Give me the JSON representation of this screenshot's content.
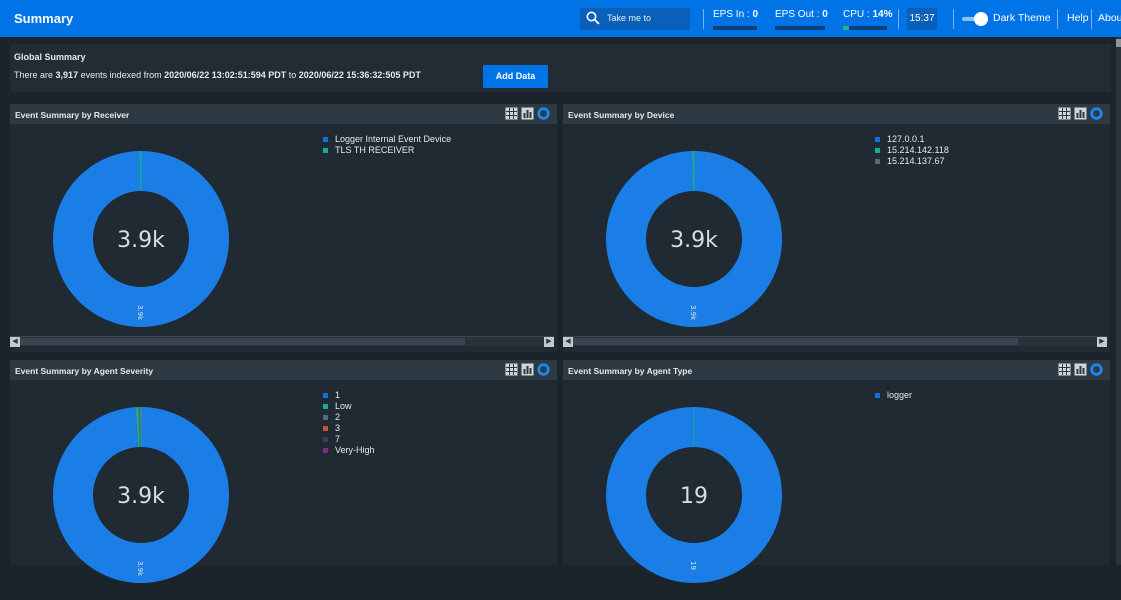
{
  "header": {
    "title": "Summary",
    "search_placeholder": "Take me to",
    "eps_in_label": "EPS In :",
    "eps_in_value": "0",
    "eps_out_label": "EPS Out :",
    "eps_out_value": "0",
    "cpu_label": "CPU :",
    "cpu_value": "14%",
    "cpu_fraction": 0.14,
    "clock": "15:37",
    "theme_label": "Dark Theme",
    "help_label": "Help",
    "about_label": "About"
  },
  "global_summary": {
    "title": "Global Summary",
    "prefix": "There are",
    "count": "3,917",
    "middle": "events indexed from",
    "from": "2020/06/22 13:02:51:594 PDT",
    "to_word": "to",
    "to": "2020/06/22 15:36:32:505 PDT",
    "add_button": "Add Data"
  },
  "panels": [
    {
      "title": "Event Summary by Receiver",
      "center": "3.9k",
      "slice_label": "3.9k",
      "legend": [
        {
          "label": "Logger Internal Event Device",
          "color": "#0f6fd6"
        },
        {
          "label": "TLS TH RECEIVER",
          "color": "#1ba89a"
        }
      ],
      "slices": [
        0.997,
        0.003
      ],
      "has_scroll": true
    },
    {
      "title": "Event Summary by Device",
      "center": "3.9k",
      "slice_label": "3.9k",
      "legend": [
        {
          "label": "127.0.0.1",
          "color": "#0f6fd6"
        },
        {
          "label": "15.214.142.118",
          "color": "#1ba89a"
        },
        {
          "label": "15.214.137.67",
          "color": "#5a6770"
        }
      ],
      "slices": [
        0.996,
        0.003,
        0.001
      ],
      "has_scroll": true
    },
    {
      "title": "Event Summary by Agent Severity",
      "center": "3.9k",
      "slice_label": "3.9k",
      "legend": [
        {
          "label": "1",
          "color": "#0f6fd6"
        },
        {
          "label": "Low",
          "color": "#1ba89a"
        },
        {
          "label": "2",
          "color": "#5a6770"
        },
        {
          "label": "3",
          "color": "#c2553a"
        },
        {
          "label": "7",
          "color": "#3a3f58"
        },
        {
          "label": "Very-High",
          "color": "#7a2f86"
        }
      ],
      "slices": [
        0.99,
        0.006,
        0.002,
        0.001,
        0.0005,
        0.0005
      ],
      "has_scroll": false
    },
    {
      "title": "Event Summary by Agent Type",
      "center": "19",
      "slice_label": "19",
      "legend": [
        {
          "label": "logger",
          "color": "#0f6fd6"
        }
      ],
      "slices": [
        1.0
      ],
      "has_scroll": false
    }
  ],
  "colors": {
    "accent": "#0073e7",
    "donut_primary": "#1a7ee6",
    "panel_bg": "#1f2a32",
    "page_bg": "#1b242b"
  }
}
